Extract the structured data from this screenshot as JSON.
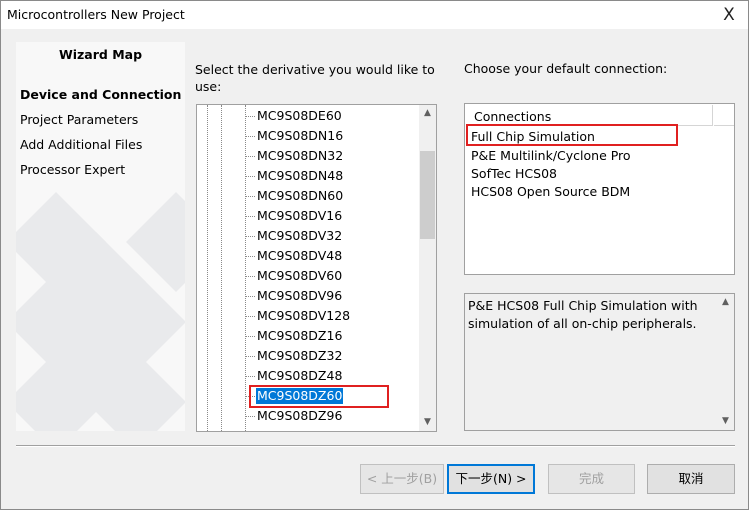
{
  "window": {
    "title": "Microcontrollers New Project",
    "close_glyph": "X"
  },
  "wizard_map": {
    "title": "Wizard Map",
    "items": [
      {
        "label": "Device and Connection",
        "active": true
      },
      {
        "label": "Project Parameters",
        "active": false
      },
      {
        "label": "Add Additional Files",
        "active": false
      },
      {
        "label": "Processor Expert",
        "active": false
      }
    ]
  },
  "derivative": {
    "prompt": "Select the derivative you would like to use:",
    "items": [
      "MC9S08DE60",
      "MC9S08DN16",
      "MC9S08DN32",
      "MC9S08DN48",
      "MC9S08DN60",
      "MC9S08DV16",
      "MC9S08DV32",
      "MC9S08DV48",
      "MC9S08DV60",
      "MC9S08DV96",
      "MC9S08DV128",
      "MC9S08DZ16",
      "MC9S08DZ32",
      "MC9S08DZ48",
      "MC9S08DZ60",
      "MC9S08DZ96"
    ],
    "selected": "MC9S08DZ60",
    "scroll_up_glyph": "▲",
    "scroll_down_glyph": "▼"
  },
  "connection": {
    "prompt": "Choose your default connection:",
    "column_header": "Connections",
    "items": [
      "Full Chip Simulation",
      "P&E Multilink/Cyclone Pro",
      "SofTec HCS08",
      "HCS08 Open Source BDM"
    ],
    "selected": "Full Chip Simulation",
    "description": "P&E HCS08 Full Chip Simulation with simulation of all on-chip peripherals."
  },
  "buttons": {
    "back": "< 上一步(B)",
    "next": "下一步(N) >",
    "finish": "完成",
    "cancel": "取消"
  },
  "colors": {
    "selection": "#0078d7",
    "annotation_box": "#e02020",
    "dialog_bg": "#f0f0f0"
  }
}
